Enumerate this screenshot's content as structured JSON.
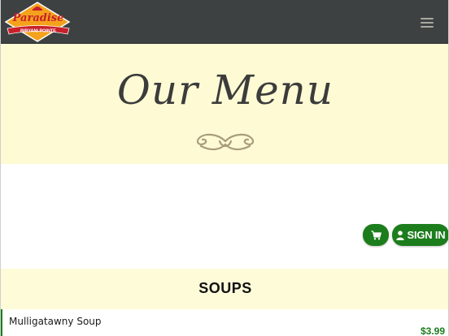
{
  "navbar": {
    "logo": {
      "brand_script": "Paradise",
      "banner_text": "BIRYANI POINTE"
    },
    "menu_icon": "hamburger-menu-icon"
  },
  "hero": {
    "title": "Our Menu",
    "ornament_icon": "flourish-ornament-icon"
  },
  "actions": {
    "cart_icon": "shopping-cart-icon",
    "signin_icon": "user-icon",
    "signin_label": "SIGN IN"
  },
  "section": {
    "title": "SOUPS"
  },
  "items": [
    {
      "name": "Mulligatawny Soup",
      "price": "$3.99"
    }
  ],
  "colors": {
    "navbar": "#3d4142",
    "hero_bg": "#fefbd4",
    "accent_green": "#1c7d1c",
    "logo_orange": "#f4a21c",
    "logo_red": "#c8202b"
  }
}
